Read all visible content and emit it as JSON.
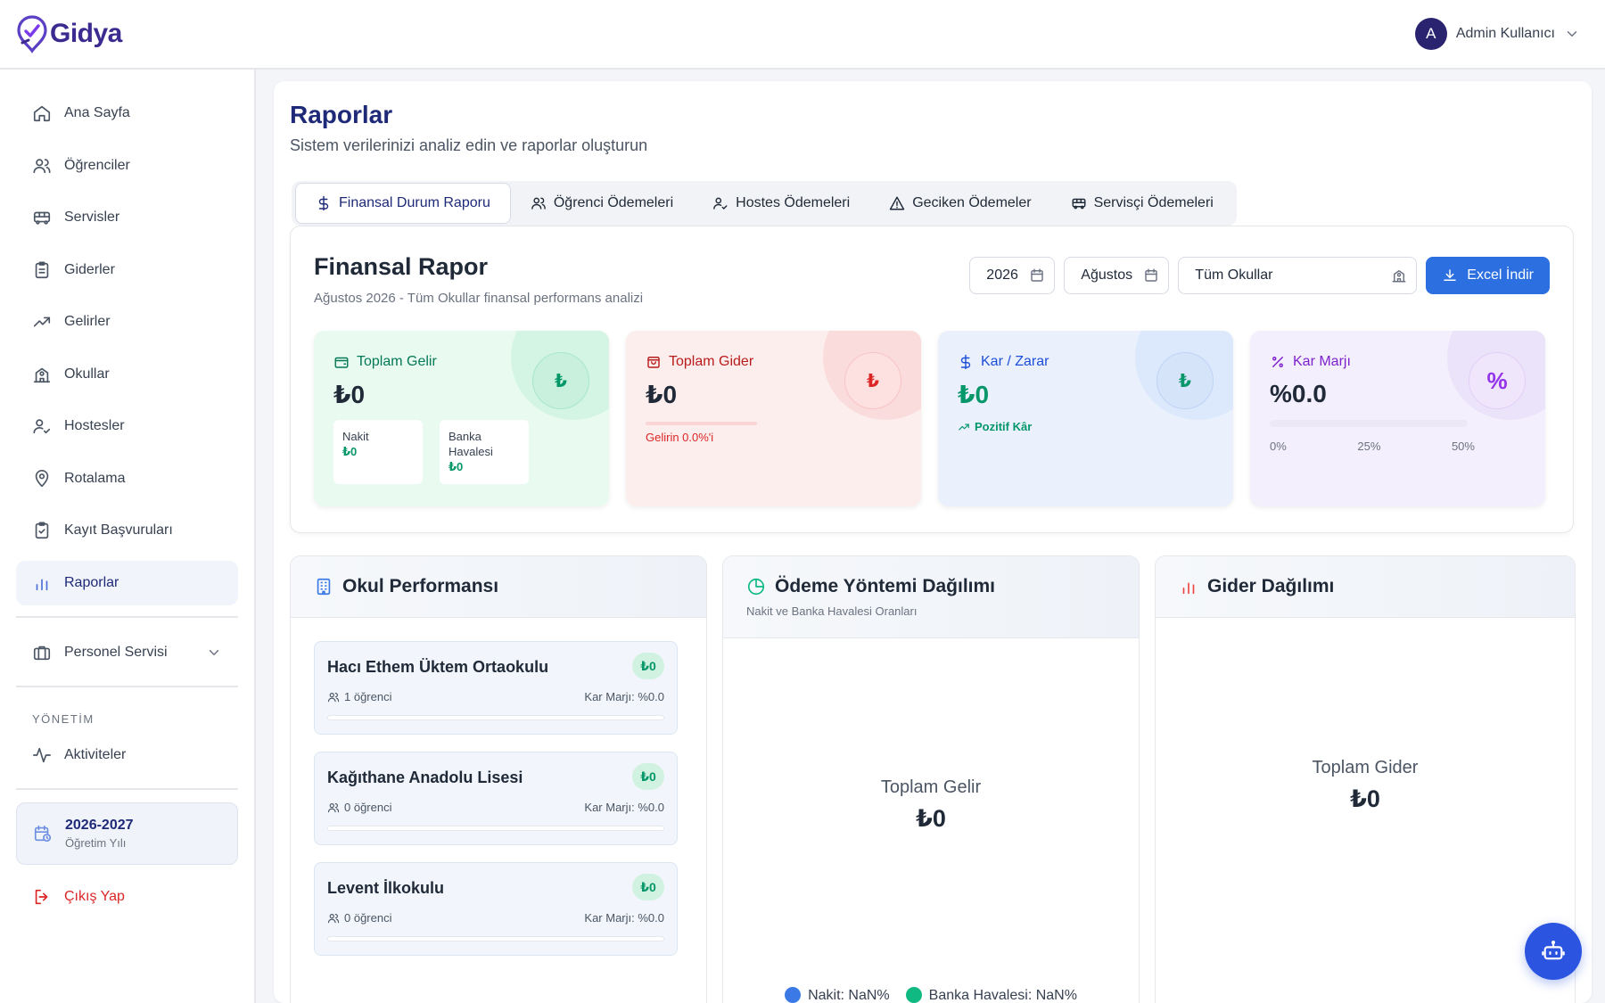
{
  "app": {
    "logo_text": "Gidya"
  },
  "user": {
    "initial": "A",
    "name": "Admin Kullanıcı"
  },
  "sidebar": {
    "items": [
      {
        "label": "Ana Sayfa",
        "icon": "home-icon"
      },
      {
        "label": "Öğrenciler",
        "icon": "users-icon"
      },
      {
        "label": "Servisler",
        "icon": "bus-icon"
      },
      {
        "label": "Giderler",
        "icon": "clipboard-icon"
      },
      {
        "label": "Gelirler",
        "icon": "trending-up-icon"
      },
      {
        "label": "Okullar",
        "icon": "school-icon"
      },
      {
        "label": "Hostesler",
        "icon": "user-check-icon"
      },
      {
        "label": "Rotalama",
        "icon": "map-pin-icon"
      },
      {
        "label": "Kayıt Başvuruları",
        "icon": "clipboard-check-icon"
      },
      {
        "label": "Raporlar",
        "icon": "bar-chart-icon",
        "active": true
      }
    ],
    "personnel": "Personel Servisi",
    "section_label": "YÖNETİM",
    "activities": "Aktiviteler",
    "year": {
      "title": "2026-2027",
      "subtitle": "Öğretim Yılı"
    },
    "logout": "Çıkış Yap"
  },
  "page": {
    "title": "Raporlar",
    "subtitle": "Sistem verilerinizi analiz edin ve raporlar oluşturun"
  },
  "tabs": [
    {
      "label": "Finansal Durum Raporu",
      "icon": "dollar-icon",
      "active": true
    },
    {
      "label": "Öğrenci Ödemeleri",
      "icon": "users-icon"
    },
    {
      "label": "Hostes Ödemeleri",
      "icon": "user-check-icon"
    },
    {
      "label": "Geciken Ödemeler",
      "icon": "alert-triangle-icon"
    },
    {
      "label": "Servisçi Ödemeleri",
      "icon": "bus-icon"
    }
  ],
  "financial": {
    "title": "Finansal Rapor",
    "subtitle": "Ağustos 2026 - Tüm Okullar finansal performans analizi",
    "filters": {
      "year": "2026",
      "month": "Ağustos",
      "school": "Tüm Okullar",
      "excel": "Excel İndir"
    },
    "income": {
      "label": "Toplam Gelir",
      "value": "₺0",
      "badge": "₺",
      "cash_label": "Nakit",
      "cash_value": "₺0",
      "bank_label": "Banka Havalesi",
      "bank_value": "₺0"
    },
    "expense": {
      "label": "Toplam Gider",
      "value": "₺0",
      "badge": "₺",
      "note": "Gelirin 0.0%'i"
    },
    "profit": {
      "label": "Kar / Zarar",
      "value": "₺0",
      "badge": "₺",
      "note": "Pozitif Kâr"
    },
    "margin": {
      "label": "Kar Marjı",
      "value": "%0.0",
      "badge": "%",
      "scale": [
        "0%",
        "25%",
        "50%"
      ]
    }
  },
  "school_perf": {
    "title": "Okul Performansı",
    "schools": [
      {
        "name": "Hacı Ethem Üktem Ortaokulu",
        "amount": "₺0",
        "students": "1 öğrenci",
        "margin": "Kar Marjı: %0.0"
      },
      {
        "name": "Kağıthane Anadolu Lisesi",
        "amount": "₺0",
        "students": "0 öğrenci",
        "margin": "Kar Marjı: %0.0"
      },
      {
        "name": "Levent İlkokulu",
        "amount": "₺0",
        "students": "0 öğrenci",
        "margin": "Kar Marjı: %0.0"
      }
    ]
  },
  "payment_dist": {
    "title": "Ödeme Yöntemi Dağılımı",
    "subtitle": "Nakit ve Banka Havalesi Oranları",
    "center_label": "Toplam Gelir",
    "center_value": "₺0",
    "legend": [
      {
        "label": "Nakit: NaN%",
        "color": "#3b7ae6"
      },
      {
        "label": "Banka Havalesi: NaN%",
        "color": "#10b981"
      }
    ]
  },
  "expense_dist": {
    "title": "Gider Dağılımı",
    "center_label": "Toplam Gider",
    "center_value": "₺0"
  },
  "colors": {
    "brand": "#1e2a78",
    "accent": "#2b6fe0",
    "success": "#059669",
    "danger": "#dc2626",
    "purple": "#9333ea"
  }
}
